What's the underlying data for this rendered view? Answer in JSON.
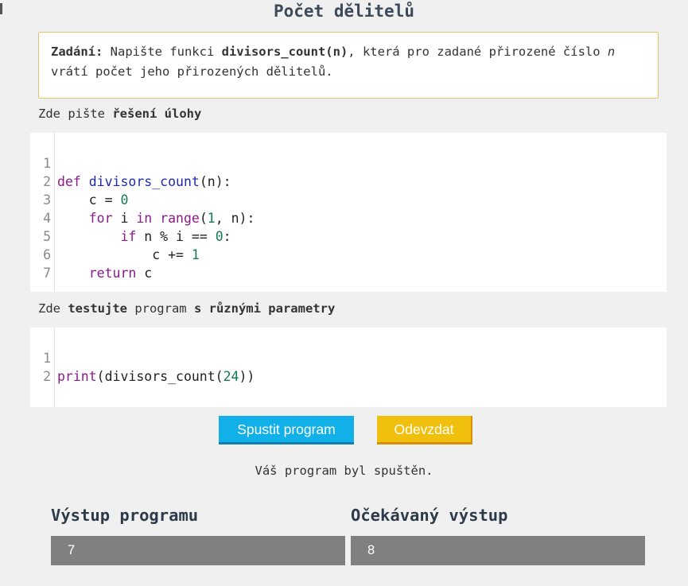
{
  "title": "Počet dělitelů",
  "assignment": {
    "prefix": "Zadání:",
    "text1": " Napište funkci ",
    "func": "divisors_count(n)",
    "text2": ", která pro zadané přirozené číslo ",
    "var": "n",
    "text3": "vrátí počet jeho přirozených dělitelů."
  },
  "solution_label": {
    "prefix": "Zde pište ",
    "bold": "řešení úlohy"
  },
  "test_label": {
    "prefix": "Zde ",
    "bold1": "testujte",
    "mid": " program ",
    "bold2": "s různými parametry"
  },
  "solution_editor": {
    "line_numbers": [
      "1",
      "2",
      "3",
      "4",
      "5",
      "6",
      "7"
    ],
    "lines": [
      "def divisors_count(n):",
      "    c = 0",
      "    for i in range(1, n):",
      "        if n % i == 0:",
      "            c += 1",
      "    return c",
      ""
    ]
  },
  "test_editor": {
    "line_numbers": [
      "1",
      "2"
    ],
    "lines": [
      "print(divisors_count(24))",
      ""
    ]
  },
  "buttons": {
    "run": "Spustit program",
    "submit": "Odevzdat"
  },
  "status": "Váš program byl spuštěn.",
  "output": {
    "actual_label": "Výstup programu",
    "actual_value": "7",
    "expected_label": "Očekávaný výstup",
    "expected_value": "8"
  },
  "colors": {
    "run_button": "#11b0e8",
    "submit_button": "#f1c00f",
    "assignment_border": "#e9c36a",
    "output_box": "#808080"
  }
}
